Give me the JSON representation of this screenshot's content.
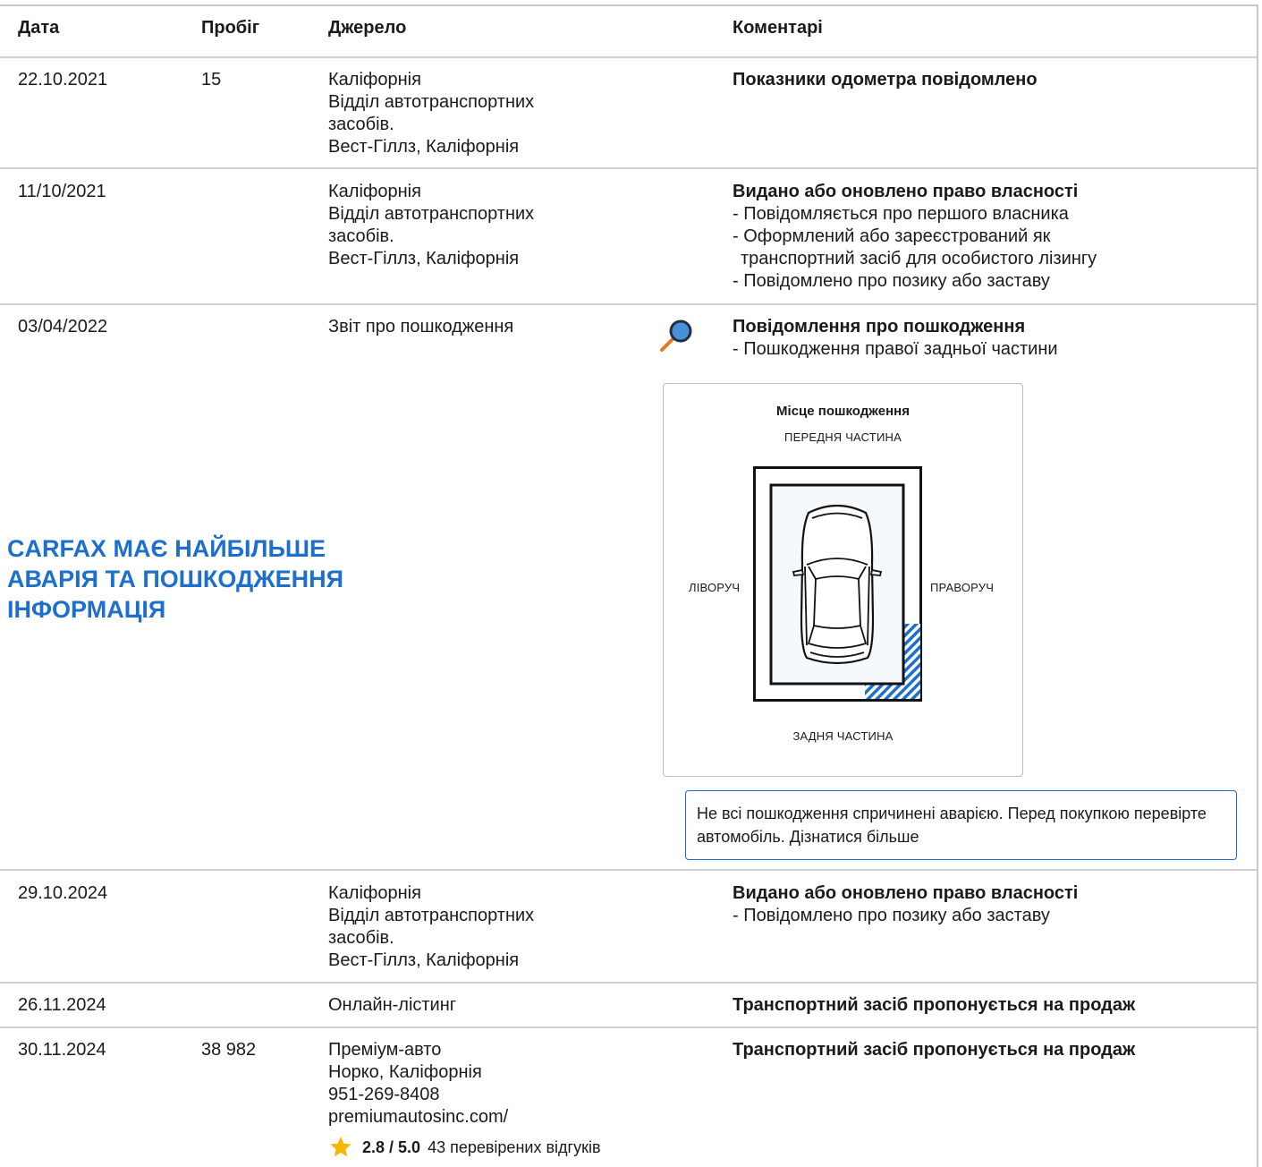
{
  "headers": {
    "date": "Дата",
    "mileage": "Пробіг",
    "source": "Джерело",
    "comments": "Коментарі"
  },
  "rows": [
    {
      "date": "22.10.2021",
      "mileage": "15",
      "source": [
        "Каліфорнія",
        "Відділ автотранспортних",
        "засобів.",
        "Вест-Гіллз, Каліфорнія"
      ],
      "comment_title": "Показники одометра повідомлено",
      "comment_items": []
    },
    {
      "date": "11/10/2021",
      "mileage": "",
      "source": [
        "Каліфорнія",
        "Відділ автотранспортних",
        "засобів.",
        "Вест-Гіллз, Каліфорнія"
      ],
      "comment_title": "Видано або оновлено право власності",
      "comment_items": [
        "- Повідомляється про першого власника",
        "- Оформлений або зареєстрований як",
        "транспортний засіб для особистого лізингу",
        "- Повідомлено про позику або заставу"
      ]
    },
    {
      "date": "03/04/2022",
      "mileage": "",
      "source": [
        "Звіт про пошкодження"
      ],
      "comment_title": "Повідомлення про пошкодження",
      "comment_items": [
        "- Пошкодження правої задньої частини"
      ]
    },
    {
      "date": "29.10.2024",
      "mileage": "",
      "source": [
        "Каліфорнія",
        "Відділ автотранспортних",
        "засобів.",
        "Вест-Гіллз, Каліфорнія"
      ],
      "comment_title": "Видано або оновлено право власності",
      "comment_items": [
        "- Повідомлено про позику або заставу"
      ]
    },
    {
      "date": "26.11.2024",
      "mileage": "",
      "source": [
        "Онлайн-лістинг"
      ],
      "comment_title": "Транспортний засіб пропонується на продаж",
      "comment_items": []
    },
    {
      "date": "30.11.2024",
      "mileage": "38 982",
      "source": [
        "Преміум-авто",
        "Норко, Каліфорнія",
        "951-269-8408",
        "premiumautosinc.com/"
      ],
      "comment_title": "Транспортний засіб пропонується на продаж",
      "comment_items": []
    }
  ],
  "promo": {
    "lines": [
      "CARFAX МАЄ НАЙБІЛЬШЕ",
      "АВАРІЯ ТА ПОШКОДЖЕННЯ",
      "ІНФОРМАЦІЯ"
    ]
  },
  "damage_diagram": {
    "title": "Місце пошкодження",
    "front": "ПЕРЕДНЯ ЧАСТИНА",
    "rear": "ЗАДНЯ ЧАСТИНА",
    "left": "ЛІВОРУЧ",
    "right": "ПРАВОРУЧ",
    "damaged_zone": "right-rear",
    "accent_color": "#1d6fce"
  },
  "notice": {
    "text": "Не всі пошкодження спричинені аварією. Перед покупкою перевірте автомобіль. Дізнатися більше"
  },
  "rating": {
    "score": "2.8 / 5.0",
    "reviews": "43 перевірених відгуків",
    "icon": "star-icon",
    "star_color": "#f5b800"
  },
  "icons": {
    "damage_search": "magnifier-icon"
  }
}
